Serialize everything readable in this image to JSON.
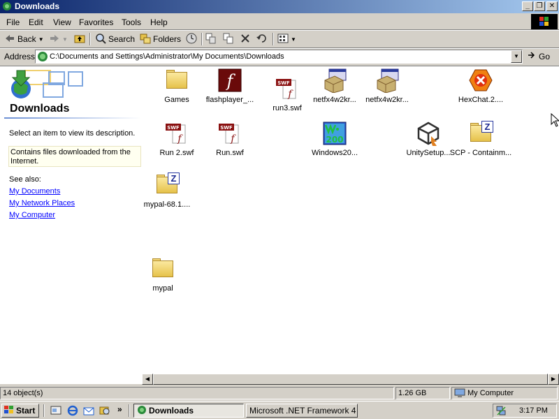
{
  "window": {
    "title": "Downloads",
    "buttons": {
      "minimize": "_",
      "maximize": "❐",
      "close": "✕"
    }
  },
  "menu": [
    "File",
    "Edit",
    "View",
    "Favorites",
    "Tools",
    "Help"
  ],
  "toolbar": {
    "back": "Back",
    "search": "Search",
    "folders": "Folders"
  },
  "address": {
    "label": "Address",
    "path": "C:\\Documents and Settings\\Administrator\\My Documents\\Downloads",
    "go": "Go"
  },
  "left_pane": {
    "title": "Downloads",
    "hint": "Select an item to view its description.",
    "description": "Contains files downloaded from the Internet.",
    "see_also": "See also:",
    "links": [
      "My Documents",
      "My Network Places",
      "My Computer"
    ]
  },
  "files": [
    {
      "label": "Games",
      "icon": "folder-icon"
    },
    {
      "label": "flashplayer_...",
      "icon": "flash-installer-icon"
    },
    {
      "label": "run3.swf",
      "icon": "swf-file-icon"
    },
    {
      "label": "netfx4w2kr...",
      "icon": "installer-box-icon"
    },
    {
      "label": "netfx4w2kr...",
      "icon": "installer-box-icon"
    },
    {
      "label": "HexChat.2....",
      "icon": "hexchat-icon"
    },
    {
      "label": "Run 2.swf",
      "icon": "swf-file-icon"
    },
    {
      "label": "Run.swf",
      "icon": "swf-file-icon"
    },
    {
      "label": "Windows20...",
      "icon": "windows2000-icon"
    },
    {
      "label": "UnitySetup...",
      "icon": "unity-icon"
    },
    {
      "label": "SCP - Containm...",
      "icon": "zip-folder-icon"
    },
    {
      "label": "mypal-68.1....",
      "icon": "zip-folder-icon"
    },
    {
      "label": "mypal",
      "icon": "folder-icon"
    }
  ],
  "status": {
    "objects": "14 object(s)",
    "size": "1.26 GB",
    "zone": "My Computer"
  },
  "taskbar": {
    "start": "Start",
    "tasks": [
      "Downloads",
      "Microsoft .NET Framework 4 ..."
    ],
    "clock": "3:17 PM"
  }
}
